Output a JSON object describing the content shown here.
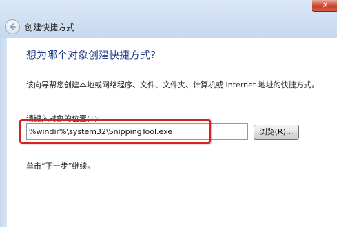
{
  "window": {
    "title": "创建快捷方式",
    "close_glyph": "✕"
  },
  "wizard": {
    "heading": "想为哪个对象创建快捷方式?",
    "description": "该向导帮您创建本地或网络程序、文件、文件夹、计算机或 Internet 地址的快捷方式。",
    "field_label": "请键入对象的位置(T):",
    "location_value": "%windir%\\system32\\SnippingTool.exe",
    "browse_label": "浏览(R)...",
    "hint": "单击“下一步”继续。"
  },
  "icons": {
    "back": "back-arrow-icon",
    "close": "close-icon"
  },
  "colors": {
    "heading": "#1f3c8a",
    "highlight": "#d62222",
    "titlebar": "#c6d9ef"
  }
}
